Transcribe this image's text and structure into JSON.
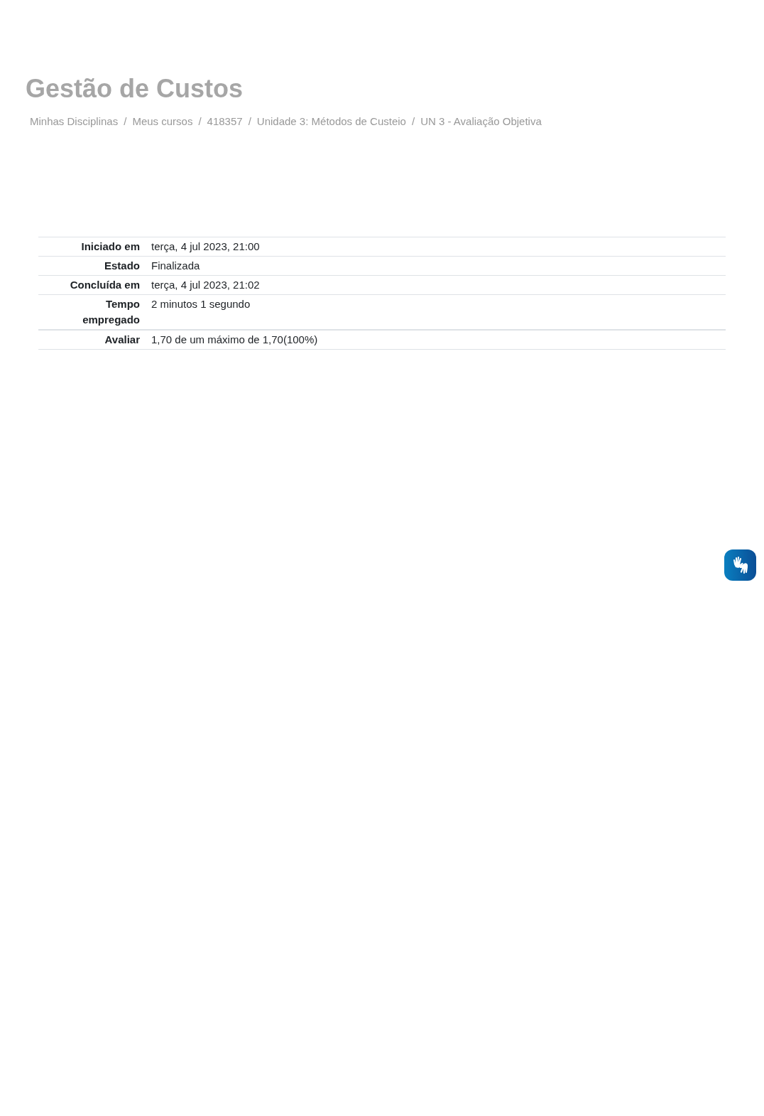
{
  "page_title": "Gestão de Custos",
  "breadcrumb": [
    {
      "label": "Minhas Disciplinas"
    },
    {
      "label": "Meus cursos"
    },
    {
      "label": "418357"
    },
    {
      "label": "Unidade 3: Métodos de Custeio"
    },
    {
      "label": "UN 3 - Avaliação Objetiva"
    }
  ],
  "breadcrumb_separator": "/",
  "summary": [
    {
      "label": "Iniciado em",
      "value": "terça, 4 jul 2023, 21:00"
    },
    {
      "label": "Estado",
      "value": "Finalizada"
    },
    {
      "label": "Concluída em",
      "value": "terça, 4 jul 2023, 21:02"
    },
    {
      "label": "Tempo empregado",
      "value": "2 minutos 1 segundo"
    },
    {
      "label": "Avaliar",
      "value": "1,70 de um máximo de 1,70(100%)"
    }
  ]
}
